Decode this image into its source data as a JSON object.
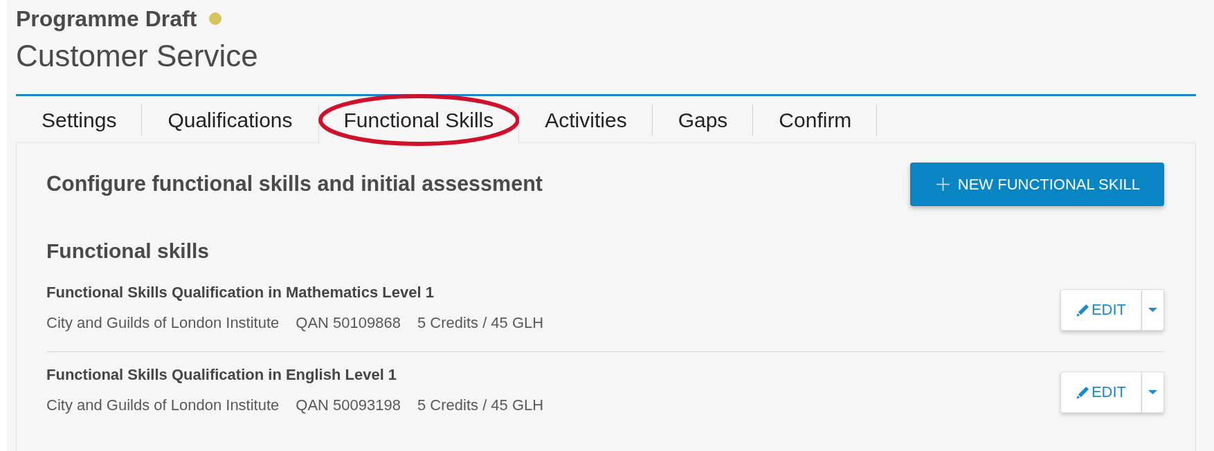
{
  "header": {
    "status": {
      "label": "Programme Draft",
      "color": "#d6c35c"
    },
    "title": "Customer Service"
  },
  "tabs": [
    {
      "label": "Settings",
      "selected": false,
      "circled": false
    },
    {
      "label": "Qualifications",
      "selected": false,
      "circled": false
    },
    {
      "label": "Functional Skills",
      "selected": true,
      "circled": true
    },
    {
      "label": "Activities",
      "selected": false,
      "circled": false
    },
    {
      "label": "Gaps",
      "selected": false,
      "circled": false
    },
    {
      "label": "Confirm",
      "selected": false,
      "circled": false
    }
  ],
  "panel": {
    "heading": "Configure functional skills and initial assessment",
    "new_button": {
      "label": "NEW FUNCTIONAL SKILL"
    }
  },
  "functional_skills": {
    "heading": "Functional skills",
    "items": [
      {
        "title": "Functional Skills Qualification in Mathematics Level 1",
        "awarding_body": "City and Guilds of London Institute",
        "qan": "QAN 50109868",
        "credits": "5 Credits / 45 GLH",
        "edit_label": "EDIT"
      },
      {
        "title": "Functional Skills Qualification in English Level 1",
        "awarding_body": "City and Guilds of London Institute",
        "qan": "QAN 50093198",
        "credits": "5 Credits / 45 GLH",
        "edit_label": "EDIT"
      }
    ]
  }
}
